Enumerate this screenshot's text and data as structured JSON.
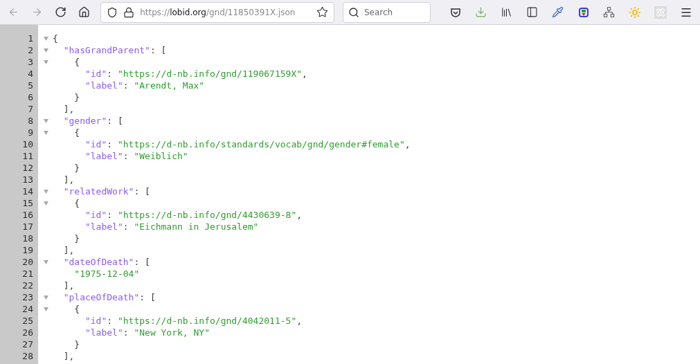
{
  "toolbar": {
    "address": {
      "scheme": "https://",
      "host": "lobid.org",
      "path": "/gnd/11850391X.json"
    },
    "search": {
      "placeholder": "Search"
    }
  },
  "code_lines": [
    {
      "number": "1",
      "foldable": true,
      "tokens": [
        {
          "kind": "punct",
          "text": "{"
        }
      ]
    },
    {
      "number": "2",
      "foldable": true,
      "tokens": [
        {
          "kind": "key",
          "text": "  \"hasGrandParent\""
        },
        {
          "kind": "punct",
          "text": ": ["
        }
      ]
    },
    {
      "number": "3",
      "foldable": true,
      "tokens": [
        {
          "kind": "punct",
          "text": "    {"
        }
      ]
    },
    {
      "number": "4",
      "foldable": false,
      "tokens": [
        {
          "kind": "key",
          "text": "      \"id\""
        },
        {
          "kind": "punct",
          "text": ": "
        },
        {
          "kind": "string",
          "text": "\"https://d-nb.info/gnd/119067159X\""
        },
        {
          "kind": "punct",
          "text": ","
        }
      ]
    },
    {
      "number": "5",
      "foldable": false,
      "tokens": [
        {
          "kind": "key",
          "text": "      \"label\""
        },
        {
          "kind": "punct",
          "text": ": "
        },
        {
          "kind": "string",
          "text": "\"Arendt, Max\""
        }
      ]
    },
    {
      "number": "6",
      "foldable": false,
      "tokens": [
        {
          "kind": "punct",
          "text": "    }"
        }
      ]
    },
    {
      "number": "7",
      "foldable": false,
      "tokens": [
        {
          "kind": "punct",
          "text": "  ],"
        }
      ]
    },
    {
      "number": "8",
      "foldable": true,
      "tokens": [
        {
          "kind": "key",
          "text": "  \"gender\""
        },
        {
          "kind": "punct",
          "text": ": ["
        }
      ]
    },
    {
      "number": "9",
      "foldable": true,
      "tokens": [
        {
          "kind": "punct",
          "text": "    {"
        }
      ]
    },
    {
      "number": "10",
      "foldable": false,
      "tokens": [
        {
          "kind": "key",
          "text": "      \"id\""
        },
        {
          "kind": "punct",
          "text": ": "
        },
        {
          "kind": "string",
          "text": "\"https://d-nb.info/standards/vocab/gnd/gender#female\""
        },
        {
          "kind": "punct",
          "text": ","
        }
      ]
    },
    {
      "number": "11",
      "foldable": false,
      "tokens": [
        {
          "kind": "key",
          "text": "      \"label\""
        },
        {
          "kind": "punct",
          "text": ": "
        },
        {
          "kind": "string",
          "text": "\"Weiblich\""
        }
      ]
    },
    {
      "number": "12",
      "foldable": false,
      "tokens": [
        {
          "kind": "punct",
          "text": "    }"
        }
      ]
    },
    {
      "number": "13",
      "foldable": false,
      "tokens": [
        {
          "kind": "punct",
          "text": "  ],"
        }
      ]
    },
    {
      "number": "14",
      "foldable": true,
      "tokens": [
        {
          "kind": "key",
          "text": "  \"relatedWork\""
        },
        {
          "kind": "punct",
          "text": ": ["
        }
      ]
    },
    {
      "number": "15",
      "foldable": true,
      "tokens": [
        {
          "kind": "punct",
          "text": "    {"
        }
      ]
    },
    {
      "number": "16",
      "foldable": false,
      "tokens": [
        {
          "kind": "key",
          "text": "      \"id\""
        },
        {
          "kind": "punct",
          "text": ": "
        },
        {
          "kind": "string",
          "text": "\"https://d-nb.info/gnd/4430639-8\""
        },
        {
          "kind": "punct",
          "text": ","
        }
      ]
    },
    {
      "number": "17",
      "foldable": false,
      "tokens": [
        {
          "kind": "key",
          "text": "      \"label\""
        },
        {
          "kind": "punct",
          "text": ": "
        },
        {
          "kind": "string",
          "text": "\"Eichmann in Jerusalem\""
        }
      ]
    },
    {
      "number": "18",
      "foldable": false,
      "tokens": [
        {
          "kind": "punct",
          "text": "    }"
        }
      ]
    },
    {
      "number": "19",
      "foldable": false,
      "tokens": [
        {
          "kind": "punct",
          "text": "  ],"
        }
      ]
    },
    {
      "number": "20",
      "foldable": true,
      "tokens": [
        {
          "kind": "key",
          "text": "  \"dateOfDeath\""
        },
        {
          "kind": "punct",
          "text": ": ["
        }
      ]
    },
    {
      "number": "21",
      "foldable": false,
      "tokens": [
        {
          "kind": "string",
          "text": "    \"1975-12-04\""
        }
      ]
    },
    {
      "number": "22",
      "foldable": false,
      "tokens": [
        {
          "kind": "punct",
          "text": "  ],"
        }
      ]
    },
    {
      "number": "23",
      "foldable": true,
      "tokens": [
        {
          "kind": "key",
          "text": "  \"placeOfDeath\""
        },
        {
          "kind": "punct",
          "text": ": ["
        }
      ]
    },
    {
      "number": "24",
      "foldable": true,
      "tokens": [
        {
          "kind": "punct",
          "text": "    {"
        }
      ]
    },
    {
      "number": "25",
      "foldable": false,
      "tokens": [
        {
          "kind": "key",
          "text": "      \"id\""
        },
        {
          "kind": "punct",
          "text": ": "
        },
        {
          "kind": "string",
          "text": "\"https://d-nb.info/gnd/4042011-5\""
        },
        {
          "kind": "punct",
          "text": ","
        }
      ]
    },
    {
      "number": "26",
      "foldable": false,
      "tokens": [
        {
          "kind": "key",
          "text": "      \"label\""
        },
        {
          "kind": "punct",
          "text": ": "
        },
        {
          "kind": "string",
          "text": "\"New York, NY\""
        }
      ]
    },
    {
      "number": "27",
      "foldable": false,
      "tokens": [
        {
          "kind": "punct",
          "text": "    }"
        }
      ]
    },
    {
      "number": "28",
      "foldable": false,
      "tokens": [
        {
          "kind": "punct",
          "text": "  ],"
        }
      ]
    }
  ]
}
